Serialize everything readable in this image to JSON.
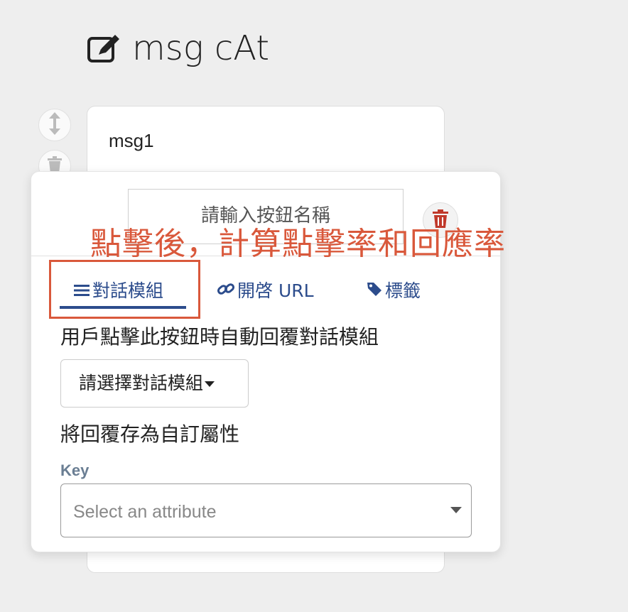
{
  "header": {
    "title": "msg cAt",
    "icon": "edit-icon"
  },
  "message": {
    "text": "msg1"
  },
  "button_editor": {
    "name_placeholder": "請輸入按鈕名稱",
    "annotation": "點擊後，計算點擊率和回應率",
    "tabs": [
      {
        "label": "對話模組",
        "icon": "list-icon",
        "active": true
      },
      {
        "label": "開啓 URL",
        "icon": "link-icon",
        "active": false
      },
      {
        "label": "標籤",
        "icon": "tag-icon",
        "active": false
      }
    ],
    "description": "用戶點擊此按鈕時自動回覆對話模組",
    "select_module_label": "請選擇對話模組",
    "save_reply_label": "將回覆存為自訂屬性",
    "key_label": "Key",
    "attribute_placeholder": "Select an attribute"
  },
  "colors": {
    "accent": "#2c4c8c",
    "annotation": "#d9583b",
    "key_label": "#6a7e93",
    "trash": "#c0392b"
  }
}
